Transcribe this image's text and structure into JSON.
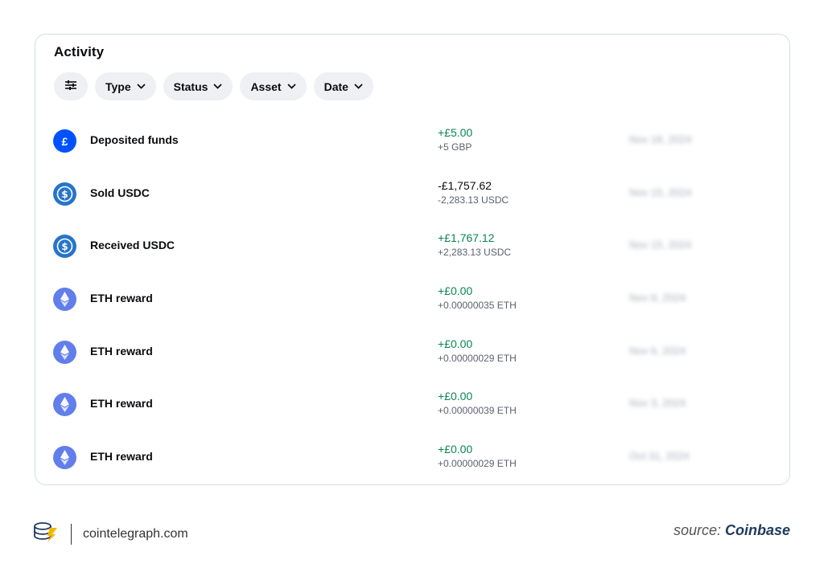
{
  "activity": {
    "title": "Activity",
    "filters": {
      "settings_icon": "sliders-icon",
      "type": "Type",
      "status": "Status",
      "asset": "Asset",
      "date": "Date"
    },
    "rows": [
      {
        "label": "Deposited funds",
        "icon": "pound-icon",
        "primary": "+£5.00",
        "secondary": "+5 GBP",
        "date": "Nov 18, 2024"
      },
      {
        "label": "Sold USDC",
        "icon": "usdc-icon",
        "primary": "-£1,757.62",
        "secondary": "-2,283.13 USDC",
        "date": "Nov 15, 2024"
      },
      {
        "label": "Received USDC",
        "icon": "usdc-icon",
        "primary": "+£1,767.12",
        "secondary": "+2,283.13 USDC",
        "date": "Nov 15, 2024"
      },
      {
        "label": "ETH reward",
        "icon": "eth-icon",
        "primary": "+£0.00",
        "secondary": "+0.00000035 ETH",
        "date": "Nov 9, 2024"
      },
      {
        "label": "ETH reward",
        "icon": "eth-icon",
        "primary": "+£0.00",
        "secondary": "+0.00000029 ETH",
        "date": "Nov 6, 2024"
      },
      {
        "label": "ETH reward",
        "icon": "eth-icon",
        "primary": "+£0.00",
        "secondary": "+0.00000039 ETH",
        "date": "Nov 3, 2024"
      },
      {
        "label": "ETH reward",
        "icon": "eth-icon",
        "primary": "+£0.00",
        "secondary": "+0.00000029 ETH",
        "date": "Oct 31, 2024"
      }
    ]
  },
  "footer": {
    "site": "cointelegraph.com",
    "source_prefix": "source: ",
    "source_name": "Coinbase"
  },
  "colors": {
    "positive": "#098551",
    "brand_blue": "#0052ff",
    "usdc_blue": "#2775ca",
    "eth_purple": "#627eea"
  }
}
